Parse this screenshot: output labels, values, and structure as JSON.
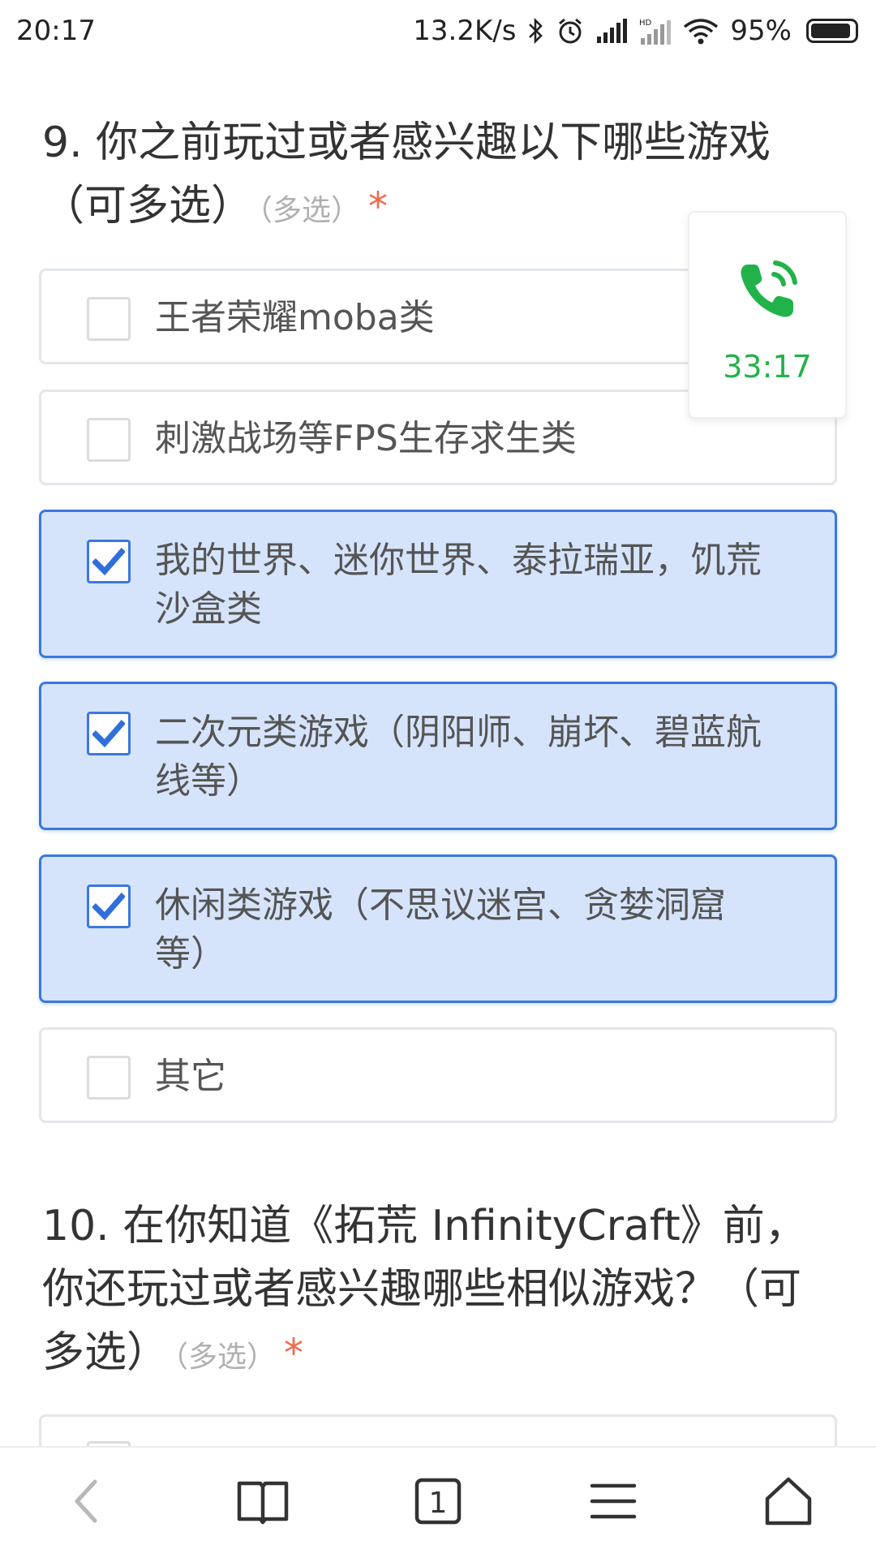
{
  "status_bar": {
    "time": "20:17",
    "net_speed": "13.2K/s",
    "battery": "95%",
    "icons": [
      "bluetooth-icon",
      "alarm-icon",
      "signal-icon",
      "hd-signal-icon",
      "wifi-icon",
      "battery-icon"
    ]
  },
  "q9": {
    "title": "9. 你之前玩过或者感兴趣以下哪些游戏（可多选）",
    "multi_tag": "（多选）",
    "required": "*",
    "options": [
      {
        "label": "王者荣耀moba类",
        "selected": false
      },
      {
        "label": "刺激战场等FPS生存求生类",
        "selected": false
      },
      {
        "label": "我的世界、迷你世界、泰拉瑞亚，饥荒沙盒类",
        "selected": true
      },
      {
        "label": "二次元类游戏（阴阳师、崩坏、碧蓝航线等）",
        "selected": true
      },
      {
        "label": "休闲类游戏（不思议迷宫、贪婪洞窟等）",
        "selected": true
      },
      {
        "label": "其它",
        "selected": false
      }
    ]
  },
  "q10": {
    "title": "10. 在你知道《拓荒 InfinityCraft》前，你还玩过或者感兴趣哪些相似游戏？（可多选）",
    "multi_tag": "（多选）",
    "required": "*"
  },
  "call_bubble": {
    "timer": "33:17",
    "icon": "phone-call-icon",
    "color": "#21b24a"
  },
  "bottom_nav": {
    "tab_count": "1",
    "icons": [
      "back-icon",
      "bookmarks-icon",
      "tabs-icon",
      "menu-icon",
      "home-icon"
    ]
  },
  "colors": {
    "selected_bg": "#d6e4fb",
    "selected_border": "#3a78e0",
    "required": "#f06a4a"
  }
}
